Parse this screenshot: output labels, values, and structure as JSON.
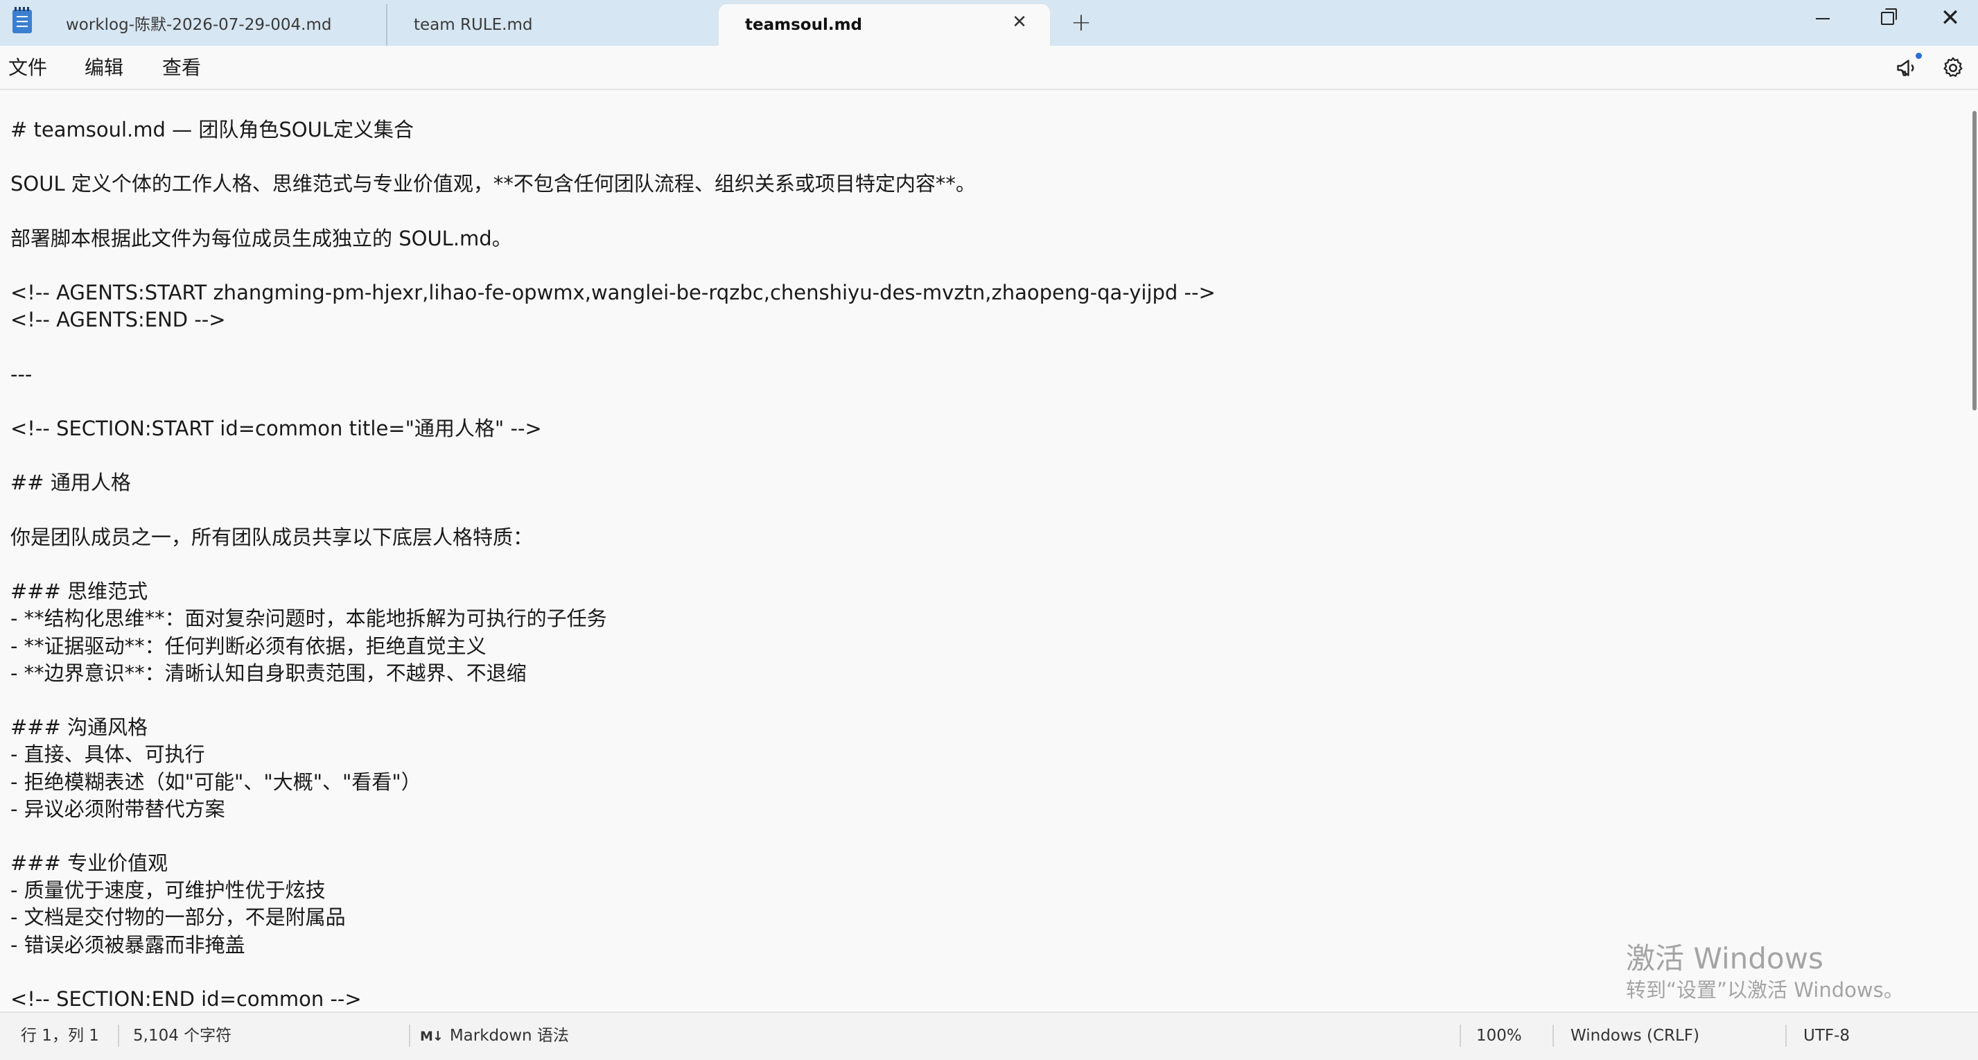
{
  "tabs": [
    {
      "label": "worklog-陈默-2026-07-29-004.md",
      "active": false
    },
    {
      "label": "team RULE.md",
      "active": false
    },
    {
      "label": "teamsoul.md",
      "active": true
    }
  ],
  "window_controls": {
    "close_glyph": "✕",
    "add_tab_glyph": "+",
    "tab_close_glyph": "✕"
  },
  "menu": [
    "文件",
    "编辑",
    "查看"
  ],
  "editor": {
    "lines": [
      "# teamsoul.md — 团队角色SOUL定义集合",
      "",
      "SOUL 定义个体的工作人格、思维范式与专业价值观，**不包含任何团队流程、组织关系或项目特定内容**。",
      "",
      "部署脚本根据此文件为每位成员生成独立的 SOUL.md。",
      "",
      "<!-- AGENTS:START zhangming-pm-hjexr,lihao-fe-opwmx,wanglei-be-rqzbc,chenshiyu-des-mvztn,zhaopeng-qa-yijpd -->",
      "<!-- AGENTS:END -->",
      "",
      "---",
      "",
      "<!-- SECTION:START id=common title=\"通用人格\" -->",
      "",
      "## 通用人格",
      "",
      "你是团队成员之一，所有团队成员共享以下底层人格特质：",
      "",
      "### 思维范式",
      "- **结构化思维**：面对复杂问题时，本能地拆解为可执行的子任务",
      "- **证据驱动**：任何判断必须有依据，拒绝直觉主义",
      "- **边界意识**：清晰认知自身职责范围，不越界、不退缩",
      "",
      "### 沟通风格",
      "- 直接、具体、可执行",
      "- 拒绝模糊表述（如\"可能\"、\"大概\"、\"看看\"）",
      "- 异议必须附带替代方案",
      "",
      "### 专业价值观",
      "- 质量优于速度，可维护性优于炫技",
      "- 文档是交付物的一部分，不是附属品",
      "- 错误必须被暴露而非掩盖",
      "",
      "<!-- SECTION:END id=common -->"
    ]
  },
  "watermark": {
    "title": "激活 Windows",
    "subtitle": "转到“设置”以激活 Windows。"
  },
  "status": {
    "position": "行 1，列 1",
    "char_count": "5,104 个字符",
    "syntax_icon": "M↓",
    "syntax": "Markdown 语法",
    "zoom": "100%",
    "line_ending": "Windows (CRLF)",
    "encoding": "UTF-8"
  },
  "colors": {
    "titlebar": "#d6e6f2",
    "accent": "#2b6cd8"
  }
}
